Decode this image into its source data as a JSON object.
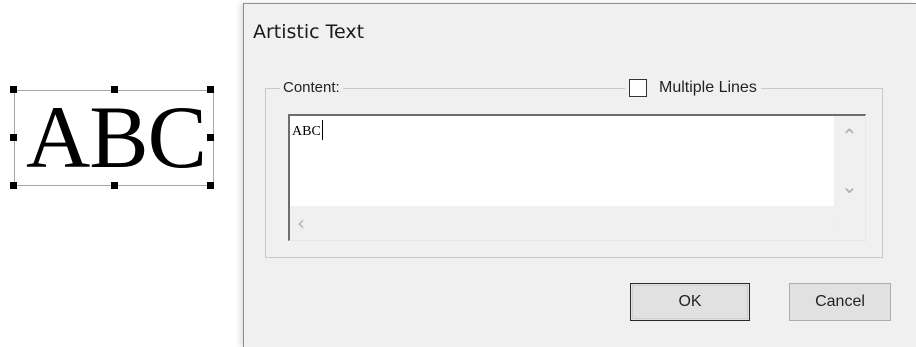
{
  "canvas": {
    "object_text": "ABC"
  },
  "dialog": {
    "title": "Artistic Text",
    "content_group": {
      "label": "Content:",
      "multiple_lines": {
        "label": "Multiple Lines",
        "checked": false
      },
      "text_value": "ABC"
    },
    "buttons": {
      "ok": "OK",
      "cancel": "Cancel"
    }
  },
  "icons": {
    "scroll_up": "chevron-up-icon",
    "scroll_down": "chevron-down-icon",
    "scroll_left": "chevron-left-icon",
    "scroll_right": "chevron-right-icon"
  }
}
